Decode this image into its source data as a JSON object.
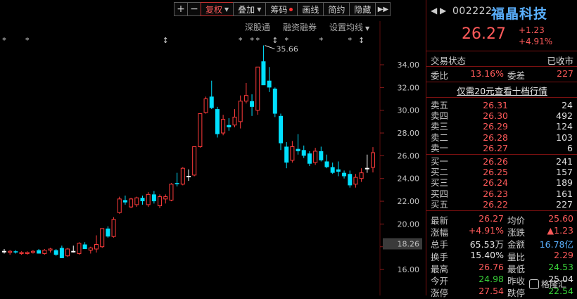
{
  "toolbar": {
    "plus": "+",
    "minus": "−",
    "restore": "复权",
    "overlay": "叠加",
    "chip": "筹码",
    "draw": "画线",
    "simple": "简约",
    "hide": "隐藏",
    "more": "▶▶"
  },
  "subbar": {
    "sz_connect": "深股通",
    "margin": "融资融券",
    "ma_setting": "设置均线"
  },
  "chart_data": {
    "type": "candlestick",
    "yaxis_ticks": [
      16,
      18,
      20,
      22,
      24,
      26,
      28,
      30,
      32,
      34
    ],
    "ylim": [
      15.2,
      36.6
    ],
    "current_price_tag": "18.26",
    "high_annotation": "35.66",
    "tick_label_format": "two_decimals",
    "candles": [
      {
        "o": 17.6,
        "h": 17.8,
        "l": 17.4,
        "c": 17.6
      },
      {
        "o": 17.5,
        "h": 17.7,
        "l": 17.3,
        "c": 17.6
      },
      {
        "o": 17.6,
        "h": 17.7,
        "l": 17.4,
        "c": 17.5
      },
      {
        "o": 17.4,
        "h": 17.6,
        "l": 17.3,
        "c": 17.5
      },
      {
        "o": 17.4,
        "h": 17.6,
        "l": 17.3,
        "c": 17.5
      },
      {
        "o": 17.5,
        "h": 17.7,
        "l": 17.4,
        "c": 17.6
      },
      {
        "o": 17.7,
        "h": 17.8,
        "l": 17.4,
        "c": 17.4
      },
      {
        "o": 17.4,
        "h": 17.8,
        "l": 17.3,
        "c": 17.7
      },
      {
        "o": 17.7,
        "h": 17.9,
        "l": 17.5,
        "c": 17.8
      },
      {
        "o": 17.7,
        "h": 17.8,
        "l": 17.2,
        "c": 17.3
      },
      {
        "o": 17.9,
        "h": 18.1,
        "l": 17.0,
        "c": 17.0
      },
      {
        "o": 17.2,
        "h": 17.9,
        "l": 17.1,
        "c": 17.8
      },
      {
        "o": 17.6,
        "h": 18.1,
        "l": 17.5,
        "c": 17.6
      },
      {
        "o": 17.4,
        "h": 18.4,
        "l": 17.3,
        "c": 18.3
      },
      {
        "o": 18.2,
        "h": 18.4,
        "l": 17.8,
        "c": 17.8
      },
      {
        "o": 17.7,
        "h": 18.0,
        "l": 17.4,
        "c": 17.9
      },
      {
        "o": 17.8,
        "h": 19.0,
        "l": 17.5,
        "c": 18.2
      },
      {
        "o": 18.0,
        "h": 19.6,
        "l": 17.9,
        "c": 19.6
      },
      {
        "o": 19.6,
        "h": 19.8,
        "l": 18.8,
        "c": 18.9
      },
      {
        "o": 18.9,
        "h": 20.6,
        "l": 18.8,
        "c": 20.4
      },
      {
        "o": 21.0,
        "h": 22.4,
        "l": 20.9,
        "c": 22.2
      },
      {
        "o": 22.1,
        "h": 22.5,
        "l": 21.7,
        "c": 21.9
      },
      {
        "o": 21.5,
        "h": 22.3,
        "l": 21.4,
        "c": 22.2
      },
      {
        "o": 21.7,
        "h": 22.4,
        "l": 21.5,
        "c": 22.3
      },
      {
        "o": 22.3,
        "h": 22.5,
        "l": 21.7,
        "c": 22.0
      },
      {
        "o": 21.7,
        "h": 22.8,
        "l": 21.5,
        "c": 22.6
      },
      {
        "o": 22.6,
        "h": 22.9,
        "l": 21.8,
        "c": 22.0
      },
      {
        "o": 21.6,
        "h": 22.6,
        "l": 21.4,
        "c": 22.4
      },
      {
        "o": 22.2,
        "h": 22.6,
        "l": 21.8,
        "c": 22.4
      },
      {
        "o": 22.1,
        "h": 23.6,
        "l": 22.0,
        "c": 23.5
      },
      {
        "o": 23.6,
        "h": 24.5,
        "l": 23.3,
        "c": 23.5
      },
      {
        "o": 23.5,
        "h": 25.0,
        "l": 23.4,
        "c": 24.9
      },
      {
        "o": 24.2,
        "h": 24.8,
        "l": 23.8,
        "c": 24.2
      },
      {
        "o": 24.3,
        "h": 26.8,
        "l": 24.2,
        "c": 26.8
      },
      {
        "o": 26.8,
        "h": 29.7,
        "l": 26.7,
        "c": 29.7
      },
      {
        "o": 29.8,
        "h": 31.2,
        "l": 29.7,
        "c": 31.0
      },
      {
        "o": 31.2,
        "h": 32.6,
        "l": 30.1,
        "c": 30.2
      },
      {
        "o": 30.1,
        "h": 30.3,
        "l": 27.6,
        "c": 27.9
      },
      {
        "o": 28.0,
        "h": 29.6,
        "l": 27.8,
        "c": 29.2
      },
      {
        "o": 28.7,
        "h": 29.3,
        "l": 28.2,
        "c": 28.5
      },
      {
        "o": 28.7,
        "h": 30.1,
        "l": 28.5,
        "c": 29.4
      },
      {
        "o": 29.0,
        "h": 31.3,
        "l": 28.4,
        "c": 30.8
      },
      {
        "o": 30.8,
        "h": 32.4,
        "l": 30.6,
        "c": 31.3
      },
      {
        "o": 30.8,
        "h": 31.4,
        "l": 29.5,
        "c": 30.3
      },
      {
        "o": 30.0,
        "h": 33.8,
        "l": 29.6,
        "c": 33.8
      },
      {
        "o": 34.3,
        "h": 35.7,
        "l": 33.6,
        "c": 32.2
      },
      {
        "o": 32.6,
        "h": 33.8,
        "l": 31.6,
        "c": 32.0
      },
      {
        "o": 31.9,
        "h": 32.0,
        "l": 29.4,
        "c": 29.7
      },
      {
        "o": 29.5,
        "h": 29.7,
        "l": 26.5,
        "c": 27.1
      },
      {
        "o": 26.8,
        "h": 27.2,
        "l": 24.9,
        "c": 25.4
      },
      {
        "o": 25.6,
        "h": 27.3,
        "l": 25.4,
        "c": 26.8
      },
      {
        "o": 26.6,
        "h": 27.9,
        "l": 26.1,
        "c": 26.4
      },
      {
        "o": 26.5,
        "h": 26.9,
        "l": 25.8,
        "c": 26.0
      },
      {
        "o": 26.2,
        "h": 26.4,
        "l": 25.1,
        "c": 25.3
      },
      {
        "o": 25.4,
        "h": 26.7,
        "l": 25.2,
        "c": 26.4
      },
      {
        "o": 26.4,
        "h": 26.8,
        "l": 25.5,
        "c": 25.6
      },
      {
        "o": 25.5,
        "h": 26.1,
        "l": 24.9,
        "c": 25.0
      },
      {
        "o": 25.0,
        "h": 25.4,
        "l": 24.4,
        "c": 24.5
      },
      {
        "o": 24.8,
        "h": 25.5,
        "l": 24.2,
        "c": 24.6
      },
      {
        "o": 24.5,
        "h": 24.7,
        "l": 24.0,
        "c": 24.2
      },
      {
        "o": 24.4,
        "h": 24.7,
        "l": 23.2,
        "c": 23.4
      },
      {
        "o": 23.5,
        "h": 24.4,
        "l": 23.2,
        "c": 24.1
      },
      {
        "o": 24.0,
        "h": 24.9,
        "l": 23.7,
        "c": 24.5
      },
      {
        "o": 24.9,
        "h": 26.1,
        "l": 24.5,
        "c": 24.9
      },
      {
        "o": 24.98,
        "h": 26.76,
        "l": 24.53,
        "c": 26.27
      }
    ],
    "up_color": "#ff3b3b",
    "down_color": "#00e0ff",
    "flat_color": "#ffffff",
    "star_markers_count": 9
  },
  "quote": {
    "arrows": "◀ ▶",
    "code": "002222",
    "name": "福晶科技",
    "price": "26.27",
    "change": "+1.23",
    "change_pct": "+4.91%",
    "trade_status_label": "交易状态",
    "trade_status": "已收市",
    "wei_bi_label": "委比",
    "wei_bi": "13.16%",
    "wei_cha_label": "委差",
    "wei_cha": "227",
    "promo": "仅需20元查看十档行情"
  },
  "orderbook": {
    "asks": [
      {
        "label": "卖五",
        "price": "26.31",
        "vol": "24"
      },
      {
        "label": "卖四",
        "price": "26.30",
        "vol": "492"
      },
      {
        "label": "卖三",
        "price": "26.29",
        "vol": "124"
      },
      {
        "label": "卖二",
        "price": "26.28",
        "vol": "103"
      },
      {
        "label": "卖一",
        "price": "26.27",
        "vol": "6"
      }
    ],
    "bids": [
      {
        "label": "买一",
        "price": "26.26",
        "vol": "241"
      },
      {
        "label": "买二",
        "price": "26.25",
        "vol": "157"
      },
      {
        "label": "买三",
        "price": "26.24",
        "vol": "189"
      },
      {
        "label": "买四",
        "price": "26.23",
        "vol": "161"
      },
      {
        "label": "买五",
        "price": "26.22",
        "vol": "227"
      }
    ]
  },
  "stats": [
    {
      "l1": "最新",
      "v1": "26.27",
      "c1": "red",
      "l2": "均价",
      "v2": "25.60",
      "c2": "red"
    },
    {
      "l1": "涨幅",
      "v1": "+4.91%",
      "c1": "red",
      "l2": "涨跌",
      "v2": "▲1.23",
      "c2": "red"
    },
    {
      "l1": "总手",
      "v1": "65.53万",
      "c1": "white",
      "l2": "金额",
      "v2": "16.78亿",
      "c2": "blue"
    },
    {
      "l1": "换手",
      "v1": "15.40%",
      "c1": "white",
      "l2": "量比",
      "v2": "2.29",
      "c2": "red"
    },
    {
      "l1": "最高",
      "v1": "26.76",
      "c1": "red",
      "l2": "最低",
      "v2": "24.53",
      "c2": "green"
    },
    {
      "l1": "今开",
      "v1": "24.98",
      "c1": "green",
      "l2": "昨收",
      "v2": "25.04",
      "c2": "white"
    },
    {
      "l1": "涨停",
      "v1": "27.54",
      "c1": "red",
      "l2": "跌停",
      "v2": "22.54",
      "c2": "green"
    }
  ],
  "watermark": "格隆汇"
}
